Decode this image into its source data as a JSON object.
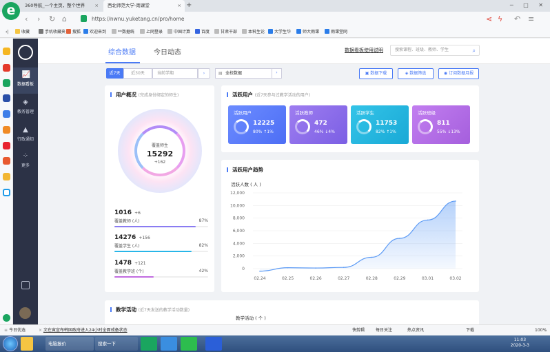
{
  "browser": {
    "tabs": [
      {
        "label": "360导航_一个主页，整个世界"
      },
      {
        "label": "西北师范大学-雨课堂"
      }
    ],
    "url": "https://nwnu.yuketang.cn/pro/home",
    "bookmarks": [
      "收藏",
      "手机收藏夹",
      "搜狐",
      "欢迎来到",
      "**数据统",
      "上网登录",
      "中国计算",
      "百度",
      "甘肃干部",
      "本科生论",
      "大学生华",
      "师大雨课",
      "雨课堂网"
    ]
  },
  "header": {
    "tab_overview": "综合数据",
    "tab_today": "今日动态",
    "guide_link": "数据看板使用说明",
    "search_placeholder": "搜索课程、班级、教师、学生"
  },
  "nav": [
    {
      "label": "数据看板",
      "icon": "chart-icon"
    },
    {
      "label": "教务管理",
      "icon": "layers-icon"
    },
    {
      "label": "行政通知",
      "icon": "bell-icon"
    },
    {
      "label": "更多",
      "icon": "grid-icon"
    }
  ],
  "filters": {
    "range_7": "近7天",
    "range_30": "近30天",
    "term": "当前学期",
    "scope": "全校数据",
    "download": "数据下载",
    "filter": "数据筛选",
    "subscribe": "订阅数据月报"
  },
  "overview": {
    "title": "用户概况",
    "subtitle": "(完成身份绑定的师生)",
    "center_label": "覆盖师生",
    "center_value": "15292",
    "center_inc": "+162",
    "stats": [
      {
        "value": "1016",
        "inc": "+6",
        "label": "覆盖教师 (人)",
        "pct": "87%",
        "ratio": 0.87,
        "color": "#8a7cf2"
      },
      {
        "value": "14276",
        "inc": "+156",
        "label": "覆盖学生 (人)",
        "pct": "82%",
        "ratio": 0.82,
        "color": "#29b6e8"
      },
      {
        "value": "1478",
        "inc": "+121",
        "label": "覆盖教学班 (个)",
        "pct": "42%",
        "ratio": 0.42,
        "color": "#c16be0"
      }
    ]
  },
  "active": {
    "title": "活跃用户",
    "subtitle": "(近7天参与过教学活动的用户)",
    "tiles": [
      {
        "name": "活跃用户",
        "value": "12225",
        "pct": "80%",
        "delta": "↑1%"
      },
      {
        "name": "活跃教师",
        "value": "472",
        "pct": "46%",
        "delta": "↓4%"
      },
      {
        "name": "活跃学生",
        "value": "11753",
        "pct": "82%",
        "delta": "↑1%"
      },
      {
        "name": "活跃班级",
        "value": "811",
        "pct": "55%",
        "delta": "↓13%"
      }
    ]
  },
  "trend": {
    "title": "活跃用户趋势",
    "ylabel": "活跃人数 ( 人 )"
  },
  "chart_data": {
    "type": "area",
    "title": "活跃用户趋势",
    "ylabel": "活跃人数 ( 人 )",
    "x": [
      "02.24",
      "02.25",
      "02.26",
      "02.27",
      "02.28",
      "02.29",
      "03.01",
      "03.02"
    ],
    "yticks": [
      "0",
      "2,000",
      "4,000",
      "6,000",
      "8,000",
      "10,000",
      "12,000"
    ],
    "ylim": [
      0,
      12000
    ],
    "values": [
      -400,
      150,
      100,
      200,
      1800,
      4800,
      7700,
      10700
    ],
    "color": "#5b9af5"
  },
  "teaching": {
    "title": "教学活动",
    "subtitle": "(近7天发送的教学活动数量)",
    "ylabel": "教学活动 ( 个 )"
  },
  "statusbar": {
    "left1": "今日优选",
    "left2": "文在寅宣布韩国政府进入24小时全面戒备状态",
    "right": [
      "快剪辑",
      "每日关注",
      "热点资讯",
      "下载",
      "100%"
    ]
  },
  "taskbar": {
    "item1": "电脑报价",
    "item2": "搜索一下",
    "time": "11:03",
    "date": "2020-3-3"
  }
}
